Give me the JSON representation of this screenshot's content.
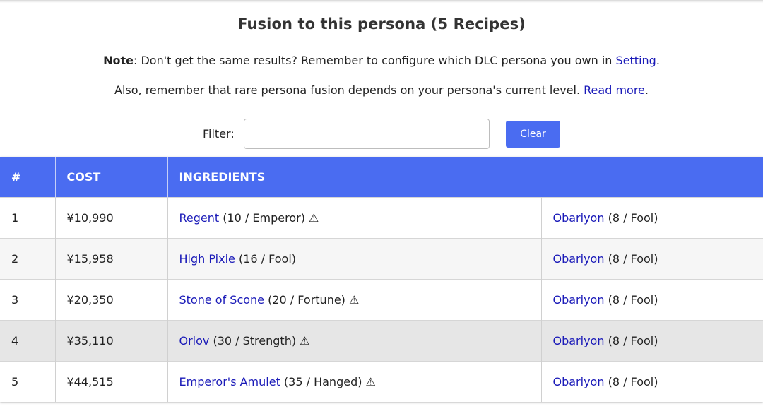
{
  "title": "Fusion to this persona (5 Recipes)",
  "note": {
    "bold": "Note",
    "text": ": Don't get the same results? Remember to configure which DLC persona you own in ",
    "link": "Setting",
    "end": "."
  },
  "note2": {
    "text": "Also, remember that rare persona fusion depends on your persona's current level. ",
    "link": "Read more",
    "end": "."
  },
  "filter": {
    "label": "Filter:",
    "value": "",
    "placeholder": "",
    "clear_label": "Clear"
  },
  "table": {
    "headers": [
      "#",
      "COST",
      "INGREDIENTS"
    ],
    "rows": [
      {
        "num": "1",
        "cost": "¥10,990",
        "ing1_name": "Regent",
        "ing1_info": " (10 / Emperor) ⚠",
        "ing2_name": "Obariyon",
        "ing2_info": " (8 / Fool)"
      },
      {
        "num": "2",
        "cost": "¥15,958",
        "ing1_name": "High Pixie",
        "ing1_info": " (16 / Fool)",
        "ing2_name": "Obariyon",
        "ing2_info": " (8 / Fool)"
      },
      {
        "num": "3",
        "cost": "¥20,350",
        "ing1_name": "Stone of Scone",
        "ing1_info": " (20 / Fortune) ⚠",
        "ing2_name": "Obariyon",
        "ing2_info": " (8 / Fool)"
      },
      {
        "num": "4",
        "cost": "¥35,110",
        "ing1_name": "Orlov",
        "ing1_info": " (30 / Strength) ⚠",
        "ing2_name": "Obariyon",
        "ing2_info": " (8 / Fool)"
      },
      {
        "num": "5",
        "cost": "¥44,515",
        "ing1_name": "Emperor's Amulet",
        "ing1_info": " (35 / Hanged) ⚠",
        "ing2_name": "Obariyon",
        "ing2_info": " (8 / Fool)"
      }
    ]
  },
  "colors": {
    "accent": "#4a6cf1",
    "link": "#1a1ab8",
    "highlight_row": "#e6e6e6"
  }
}
